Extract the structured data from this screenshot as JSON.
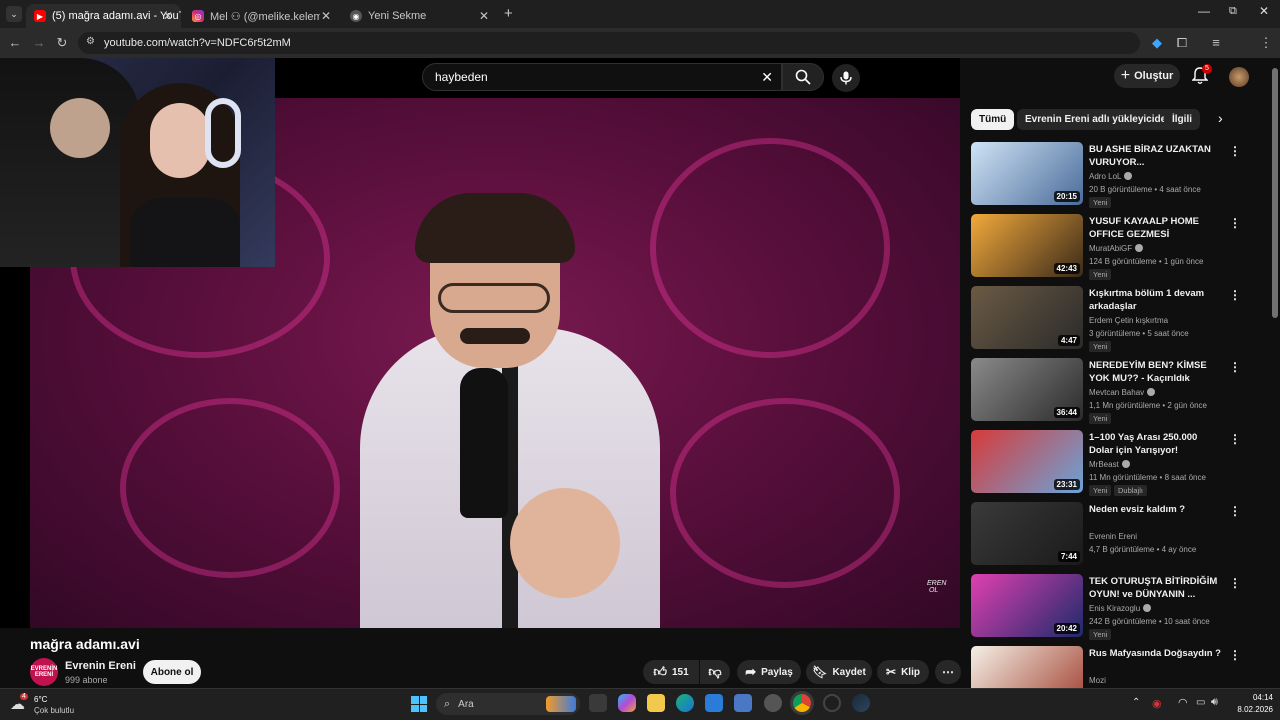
{
  "browser": {
    "tabs": [
      {
        "label": "(5) mağra adamı.avi - YouTube",
        "active": true
      },
      {
        "label": "Mel  ⚇ (@melike.kelem_) • Inst",
        "active": false
      },
      {
        "label": "Yeni Sekme",
        "active": false
      }
    ],
    "url": "youtube.com/watch?v=NDFC6r5t2mM",
    "new_tab_label": "+"
  },
  "masthead": {
    "search_value": "haybeden",
    "create_label": "Oluştur",
    "notifications_count": "5"
  },
  "video": {
    "title": "mağra adamı.avi",
    "watermark": "EREN\nOL"
  },
  "channel": {
    "name": "Evrenin Ereni",
    "subscribers": "999 abone",
    "avatar_text": "EVRENİN ERENİ",
    "subscribe_label": "Abone ol"
  },
  "actions": {
    "likes": "151",
    "share_label": "Paylaş",
    "save_label": "Kaydet",
    "clip_label": "Klip"
  },
  "chips": [
    "Tümü",
    "Evrenin Ereni adlı yükleyiciden",
    "İlgili"
  ],
  "recommendations": [
    {
      "title": "BU ASHE BİRAZ UZAKTAN VURUYOR...",
      "channel": "Adro LoL",
      "verified": true,
      "meta": "20 B görüntüleme • 4 saat önce",
      "badge": "Yeni",
      "duration": "20:15",
      "colors": [
        "#cfe3f5",
        "#4a6c9a"
      ]
    },
    {
      "title": "YUSUF KAYAALP HOME OFFICE GEZMESİ @YusufKayaalp",
      "channel": "MuratAbiGF",
      "verified": true,
      "meta": "124 B görüntüleme • 1 gün önce",
      "badge": "Yeni",
      "duration": "42:43",
      "colors": [
        "#f2a93b",
        "#3a2a1a"
      ]
    },
    {
      "title": "Kışkırtma bölüm 1 devam arkadaşlar",
      "channel": "Erdem Çetin kışkırtma",
      "verified": false,
      "meta": "3 görüntüleme • 5 saat önce",
      "badge": "Yeni",
      "duration": "4:47",
      "colors": [
        "#6b5a44",
        "#2a2a2a"
      ]
    },
    {
      "title": "NEREDEYİM BEN? KİMSE YOK MU?? - Kaçırıldık",
      "channel": "Mevtcan Bahav",
      "verified": true,
      "meta": "1,1 Mn görüntüleme • 2 gün önce",
      "badge": "Yeni",
      "duration": "36:44",
      "colors": [
        "#8a8a8a",
        "#2b2b2b"
      ]
    },
    {
      "title": "1–100 Yaş Arası 250.000 Dolar için Yarışıyor!",
      "channel": "MrBeast",
      "verified": true,
      "meta": "11 Mn görüntüleme • 8 saat önce",
      "badge": "Yeni",
      "badge2": "Dublajlı",
      "duration": "23:31",
      "colors": [
        "#d83a3a",
        "#6aa4d8"
      ]
    },
    {
      "title": "Neden evsiz kaldım ?",
      "channel": "Evrenin Ereni",
      "verified": false,
      "meta": "4,7 B görüntüleme • 4 ay önce",
      "badge": "",
      "duration": "7:44",
      "colors": [
        "#3a3a3a",
        "#1a1a1a"
      ]
    },
    {
      "title": "TEK OTURUŞTA BİTİRDİĞİM OYUN! ve DÜNYANIN ...",
      "channel": "Enis Kirazoglu",
      "verified": true,
      "meta": "242 B görüntüleme • 10 saat önce",
      "badge": "Yeni",
      "duration": "20:42",
      "colors": [
        "#e040b0",
        "#1c2a6a"
      ]
    },
    {
      "title": "Rus Mafyasında Doğsaydın ?",
      "channel": "Mozi",
      "verified": false,
      "meta": "88 B görüntüleme • 7 gün önce",
      "badge": "",
      "duration": "",
      "colors": [
        "#f5f0e6",
        "#a04030"
      ]
    }
  ],
  "taskbar": {
    "weather_temp": "6°C",
    "weather_desc": "Çok bulutlu",
    "weather_badge": "4",
    "search_placeholder": "Ara",
    "time": "04:14",
    "date": "8.02.2026"
  }
}
